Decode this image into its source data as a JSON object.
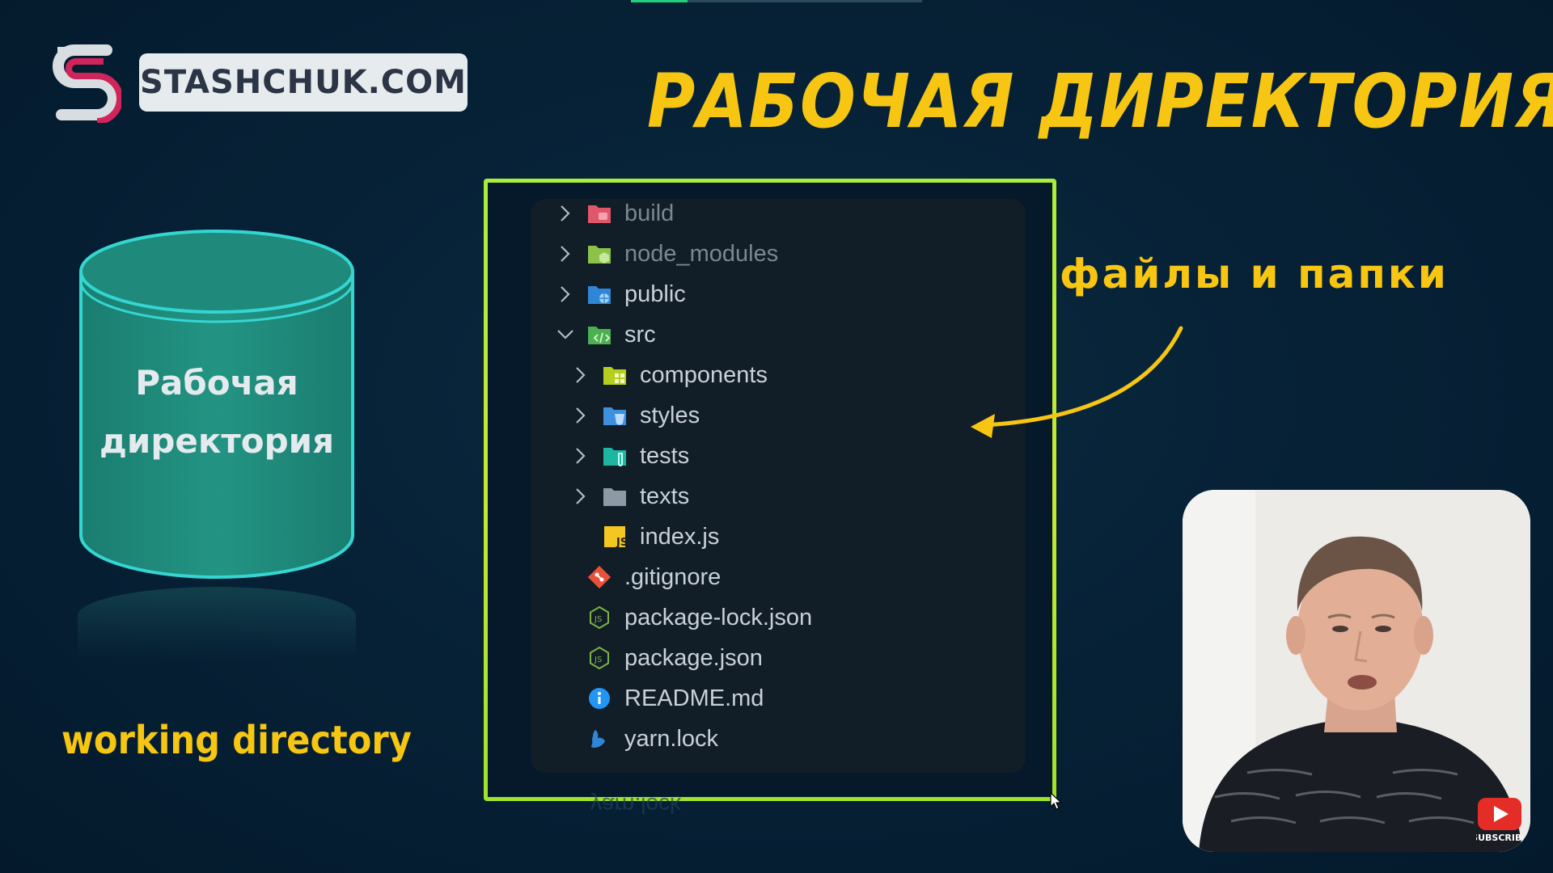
{
  "brand": {
    "site": "STASHCHUK.COM"
  },
  "title": "РАБОЧАЯ ДИРЕКТОРИЯ",
  "cylinder": {
    "label_line1": "Рабочая",
    "label_line2": "директория"
  },
  "caption": "working directory",
  "annotation": "файлы и папки",
  "explorer": {
    "items": [
      {
        "name": "build",
        "icon": "folder-build-icon",
        "expanded": false,
        "depth": 0
      },
      {
        "name": "node_modules",
        "icon": "folder-node-icon",
        "expanded": false,
        "depth": 0
      },
      {
        "name": "public",
        "icon": "folder-public-icon",
        "expanded": false,
        "depth": 0
      },
      {
        "name": "src",
        "icon": "folder-src-icon",
        "expanded": true,
        "depth": 0
      },
      {
        "name": "components",
        "icon": "folder-components-icon",
        "expanded": false,
        "depth": 1
      },
      {
        "name": "styles",
        "icon": "folder-styles-icon",
        "expanded": false,
        "depth": 1
      },
      {
        "name": "tests",
        "icon": "folder-tests-icon",
        "expanded": false,
        "depth": 1
      },
      {
        "name": "texts",
        "icon": "folder-icon",
        "expanded": false,
        "depth": 1
      },
      {
        "name": "index.js",
        "icon": "js-file-icon",
        "depth": 1
      },
      {
        "name": ".gitignore",
        "icon": "git-icon",
        "depth": 0
      },
      {
        "name": "package-lock.json",
        "icon": "nodejs-icon",
        "depth": 0
      },
      {
        "name": "package.json",
        "icon": "nodejs-icon",
        "depth": 0
      },
      {
        "name": "README.md",
        "icon": "info-icon",
        "depth": 0
      },
      {
        "name": "yarn.lock",
        "icon": "yarn-icon",
        "depth": 0
      }
    ],
    "reflection_text": "yarn.lock"
  },
  "youtube": {
    "label": "SUBSCRIBE"
  },
  "colors": {
    "accent_yellow": "#f6c612",
    "frame_green": "#b8ea34",
    "cylinder_teal": "#1f8a7c",
    "background": "#062035"
  }
}
